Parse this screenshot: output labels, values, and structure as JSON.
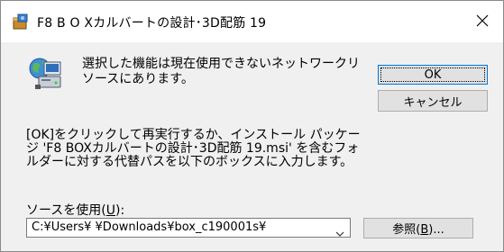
{
  "window": {
    "title": "F8 B O Xカルバートの設計･3D配筋 19",
    "icon": "installer-package-icon",
    "close_icon": "close-icon"
  },
  "dialog": {
    "icon": "network-drive-icon",
    "message": "選択した機能は現在使用できないネットワークリソースにあります。",
    "instruction": "[OK]をクリックして再実行するか、インストール パッケージ 'F8 BOXカルバートの設計･3D配筋 19.msi' を含むフォルダーに対する代替パスを以下のボックスに入力します。",
    "source_label": "ソースを使用(",
    "source_label_accel": "U",
    "source_label_end": "):",
    "source_value": "C:¥Users¥  ¥Downloads¥box_c190001s¥",
    "dropdown_icon": "chevron-down-icon"
  },
  "buttons": {
    "ok": "OK",
    "cancel": "キャンセル",
    "browse_prefix": "参照(",
    "browse_accel": "B",
    "browse_suffix": ")..."
  }
}
